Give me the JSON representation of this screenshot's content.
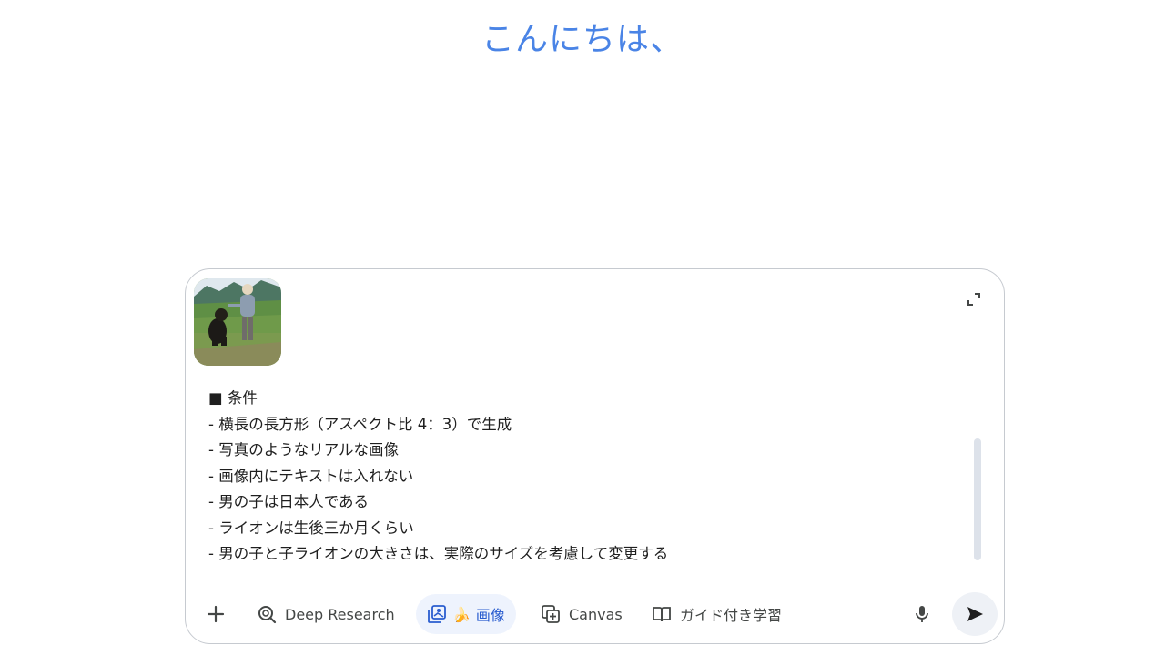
{
  "greeting": "こんにちは、",
  "composer": {
    "prompt_lines": [
      "■ 条件",
      "- 横長の長方形（アスペクト比 4：3）で生成",
      "- 写真のようなリアルな画像",
      "- 画像内にテキストは入れない",
      "- 男の子は日本人である",
      "- ライオンは生後三か月くらい",
      "- 男の子と子ライオンの大きさは、実際のサイズを考慮して変更する"
    ],
    "attachment_icon": "photo-thumbnail-boy-with-dog"
  },
  "toolbar": {
    "add_icon": "plus-icon",
    "deep_research_label": "Deep Research",
    "deep_research_icon": "deep-research-icon",
    "image_label": "画像",
    "image_icon": "image-gallery-icon",
    "image_emoji": "🍌",
    "canvas_label": "Canvas",
    "canvas_icon": "canvas-icon",
    "guide_label": "ガイド付き学習",
    "guide_icon": "book-icon",
    "mic_icon": "microphone-icon",
    "send_icon": "send-icon"
  },
  "colors": {
    "greeting": "#4a84e6",
    "active_tool_bg": "#eef3fd",
    "active_tool_text": "#2a5dcf",
    "send_bg": "#eef1f6"
  }
}
